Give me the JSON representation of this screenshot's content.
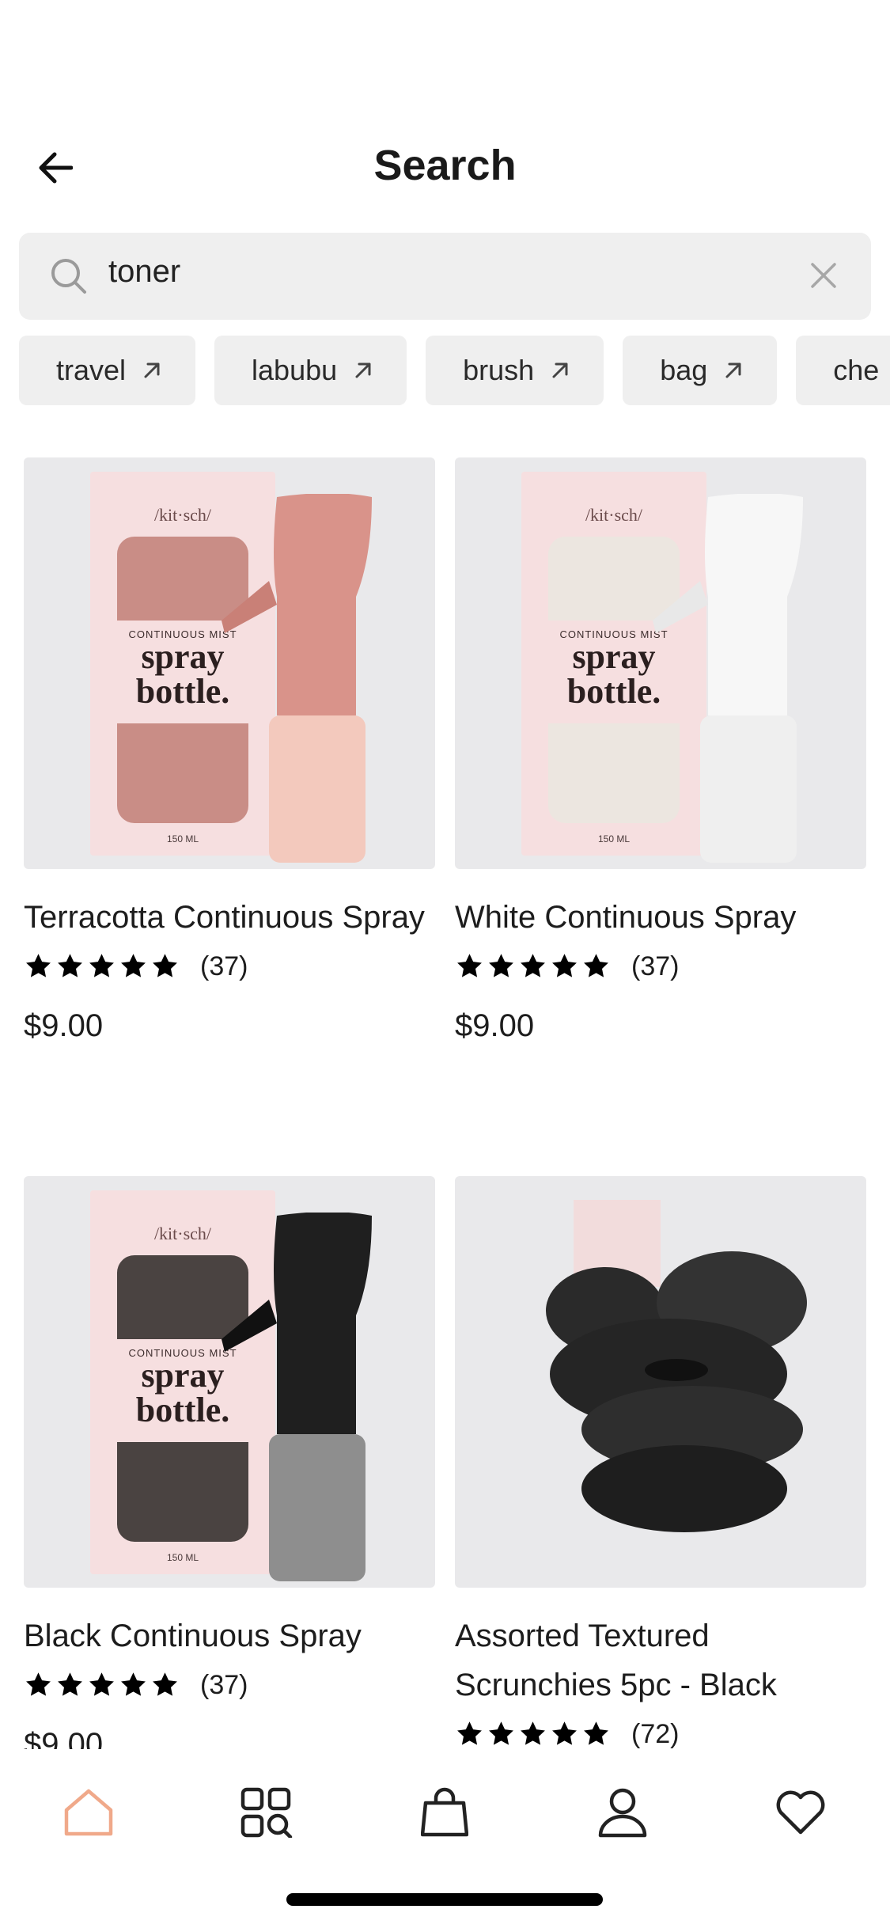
{
  "header": {
    "title": "Search"
  },
  "search": {
    "query": "toner"
  },
  "chips": [
    "travel",
    "labubu",
    "brush",
    "bag",
    "che"
  ],
  "products": [
    {
      "name": "Terracotta Continuous Spray",
      "reviews": "(37)",
      "price": "$9.00",
      "rating": 5,
      "image_icon": "terracotta-spray-bottle-image",
      "bottle_color": "#d9938a",
      "base_color": "#f3c9bd"
    },
    {
      "name": "White Continuous Spray",
      "reviews": "(37)",
      "price": "$9.00",
      "rating": 5,
      "image_icon": "white-spray-bottle-image",
      "bottle_color": "#f4f4f4",
      "base_color": "#f2f2f2"
    },
    {
      "name": "Black Continuous Spray",
      "reviews": "(37)",
      "price": "$9.00",
      "rating": 5,
      "image_icon": "black-spray-bottle-image",
      "bottle_color": "#1f1f1f",
      "base_color": "#8e8e8e"
    },
    {
      "name": "Assorted Textured Scrunchies 5pc - Black",
      "reviews": "(72)",
      "price": "",
      "rating": 5,
      "image_icon": "black-scrunchies-image"
    }
  ],
  "box_text": {
    "brand": "/kit·sch/",
    "line1": "CONTINUOUS MIST",
    "line2": "spray",
    "line3": "bottle.",
    "volume": "150 ML"
  },
  "tabs": [
    "home-icon",
    "browse-search-icon",
    "shopping-bag-icon",
    "account-icon",
    "wishlist-heart-icon"
  ],
  "colors": {
    "active_tab": "#f0a98a",
    "chip_bg": "#efefef",
    "image_bg": "#e9e9eb"
  }
}
